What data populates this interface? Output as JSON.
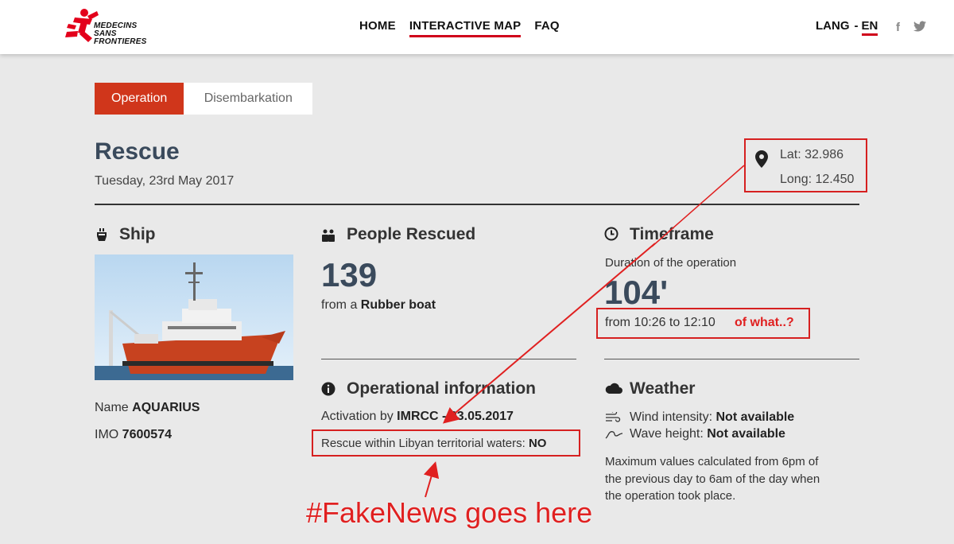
{
  "header": {
    "logo_text_line1": "MEDECINS",
    "logo_text_line2": "SANS FRONTIERES",
    "nav": [
      "HOME",
      "INTERACTIVE MAP",
      "FAQ"
    ],
    "lang_label": "LANG",
    "lang_dash": "-",
    "lang_current": "EN",
    "social_fb": "f",
    "social_tw": "🐦",
    "accent_color": "#d0021b"
  },
  "tabs": [
    "Operation",
    "Disembarkation"
  ],
  "operation": {
    "title": "Rescue",
    "date": "Tuesday, 23rd May 2017",
    "lat_text": "Lat: 32.986",
    "long_text": "Long: 12.450"
  },
  "ship": {
    "heading": "Ship",
    "name_label": "Name",
    "name_value": "AQUARIUS",
    "imo_label": "IMO",
    "imo_value": "7600574",
    "icon": "ship-icon"
  },
  "people": {
    "heading": "People Rescued",
    "count": "139",
    "from_label": "from a",
    "boat": "Rubber boat",
    "icon": "people-icon"
  },
  "timeframe": {
    "heading": "Timeframe",
    "duration_label": "Duration of the operation",
    "duration": "104'",
    "range": "from 10:26 to 12:10",
    "icon": "clock-icon"
  },
  "operational": {
    "heading": "Operational information",
    "activation_label": "Activation by",
    "activation_value": "IMRCC - 23.05.2017",
    "libyan_label": "Rescue within Libyan territorial waters:",
    "libyan_value": "NO",
    "icon": "info-icon"
  },
  "weather": {
    "heading": "Weather",
    "wind_label": "Wind intensity:",
    "wind_value": "Not available",
    "wave_label": "Wave height:",
    "wave_value": "Not available",
    "note_line1": "Maximum values calculated from 6pm of",
    "note_line2": "the previous day to 6am of the day when",
    "note_line3": "the operation took place.",
    "icon": "cloud-icon"
  },
  "annotations": {
    "of_what": "of what..?",
    "fakenews": "#FakeNews goes here",
    "color": "#e02020"
  }
}
